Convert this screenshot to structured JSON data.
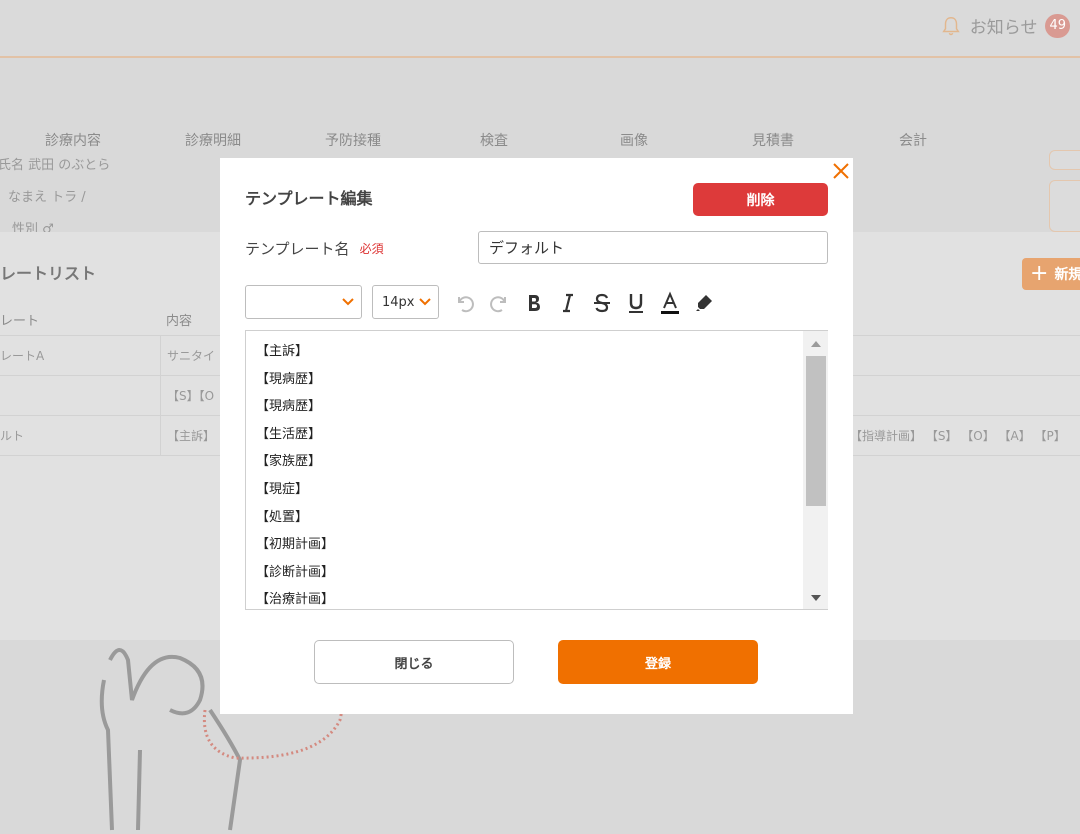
{
  "header": {
    "notification_label": "お知らせ",
    "notification_count": "49"
  },
  "nav": {
    "tabs": [
      "診療内容",
      "診療明細",
      "予防接種",
      "検査",
      "画像",
      "見積書",
      "会計"
    ]
  },
  "patient": {
    "name_line": "氏名  武田 のぶとら",
    "kana_line": "なまえ  トラ  /",
    "sex_line": "性別  ♂"
  },
  "template_list": {
    "title": "レートリスト",
    "new_button_label": "新規",
    "columns": [
      "レート",
      "内容"
    ],
    "rows": [
      {
        "name": "レートA",
        "content": "サニタイ"
      },
      {
        "name": "",
        "content": "【S】【O"
      },
      {
        "name": "ルト",
        "content": "【主訴】",
        "content_tail": "【指導計画】 【S】 【O】 【A】 【P】"
      }
    ]
  },
  "modal": {
    "title": "テンプレート編集",
    "delete_label": "削除",
    "name_label": "テンプレート名",
    "required_label": "必須",
    "name_value": "デフォルト",
    "font_family_value": "",
    "font_size_value": "14px",
    "editor_lines": [
      "【主訴】",
      "【現病歴】",
      "【現病歴】",
      "【生活歴】",
      "【家族歴】",
      "【現症】",
      "【処置】",
      "【初期計画】",
      "【診断計画】",
      "【治療計画】"
    ],
    "close_label": "閉じる",
    "save_label": "登録"
  },
  "colors": {
    "accent": "#f07000",
    "danger": "#dd3a3a"
  }
}
